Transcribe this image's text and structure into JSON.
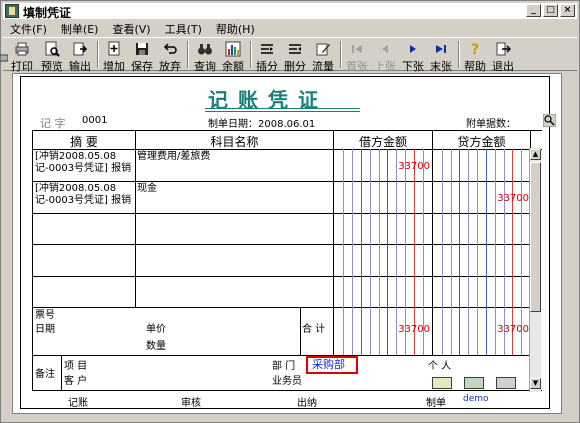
{
  "window": {
    "title": "填制凭证"
  },
  "menus": [
    "文件(F)",
    "制单(E)",
    "查看(V)",
    "工具(T)",
    "帮助(H)"
  ],
  "toolbar": [
    "打印",
    "预览",
    "输出",
    "增加",
    "保存",
    "放弃",
    "查询",
    "余额",
    "插分",
    "删分",
    "流量",
    "首张",
    "上张",
    "下张",
    "末张",
    "帮助",
    "退出"
  ],
  "voucher": {
    "title": "记账凭证",
    "type_label": "记 字",
    "number": "0001",
    "date_label": "制单日期：2008.06.01",
    "attachments_label": "附单据数：",
    "headers": {
      "summary": "摘 要",
      "account": "科目名称",
      "debit": "借方金额",
      "credit": "贷方金额"
    },
    "rows": [
      {
        "summary": "[冲销2008.05.08 记-0003号凭证] 报销",
        "account": "管理费用/差旅费",
        "debit": "33700",
        "credit": ""
      },
      {
        "summary": "[冲销2008.05.08 记-0003号凭证] 报销",
        "account": "现金",
        "debit": "",
        "credit": "33700"
      }
    ],
    "bill_no_label": "票号",
    "date_row_label": "日期",
    "unit_price_label": "单价",
    "quantity_label": "数量",
    "total_label": "合 计",
    "total_debit": "33700",
    "total_credit": "33700",
    "remark_label": "备注",
    "project_label": "项  目",
    "customer_label": "客  户",
    "dept_label": "部  门",
    "dept_value": "采购部",
    "person_label": "个  人",
    "salesman_label": "业务员",
    "footer": {
      "posted": "记账",
      "audit": "审核",
      "cashier": "出纳",
      "maker": "制单",
      "maker_value": "demo"
    }
  },
  "colors": {
    "title": "#1a7f7a",
    "amount": "#d00000",
    "highlight_border": "#e00000",
    "dept_text": "#1030d0"
  }
}
